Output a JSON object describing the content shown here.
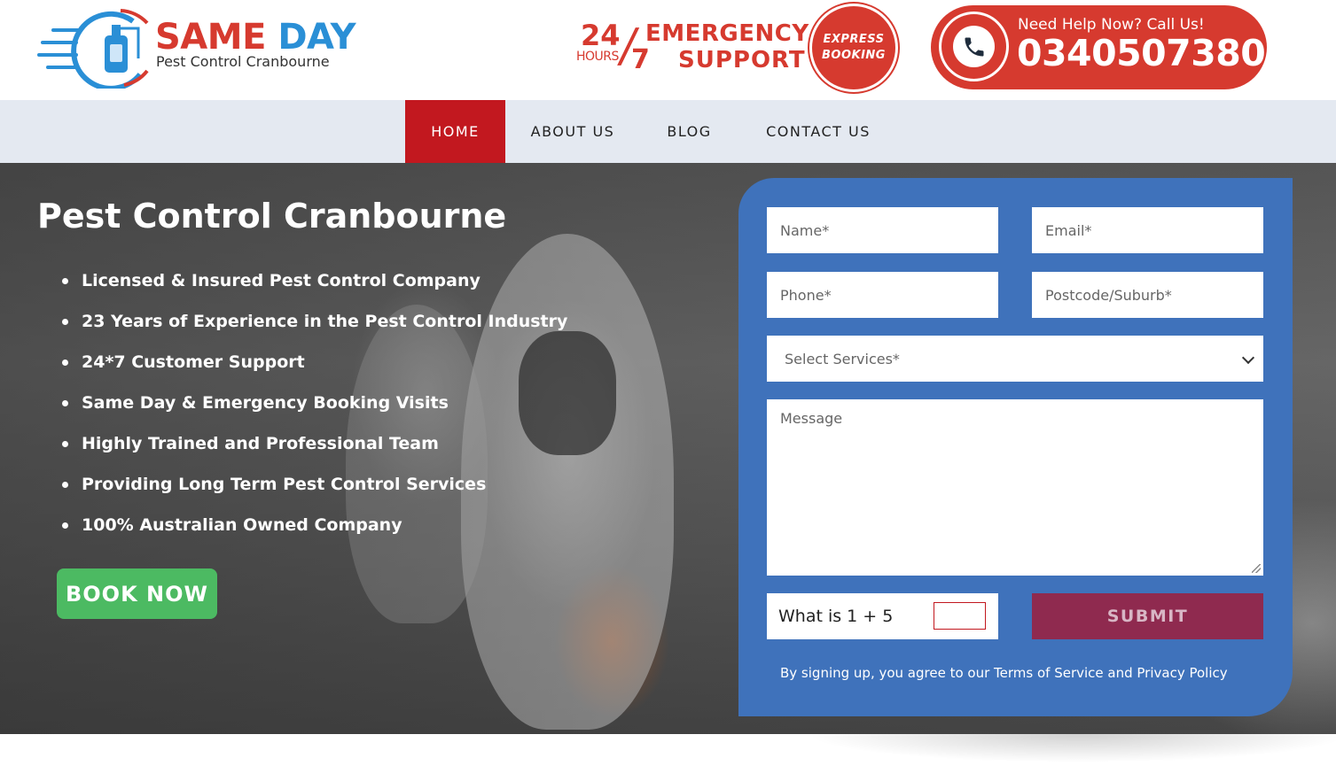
{
  "header": {
    "logo": {
      "title_part1": "SAME",
      "title_part2": "DAY",
      "subtitle": "Pest Control Cranbourne"
    },
    "emergency": {
      "num24": "24",
      "hours": "HOURS",
      "num7": "7",
      "line1": "EMERGENCY",
      "line2": "SUPPORT"
    },
    "express": {
      "line1": "EXPRESS",
      "line2": "BOOKING"
    },
    "call": {
      "label": "Need Help Now? Call Us!",
      "number": "0340507380",
      "icon": "phone-icon"
    }
  },
  "nav": {
    "items": [
      {
        "label": "HOME",
        "active": true
      },
      {
        "label": "ABOUT US",
        "active": false
      },
      {
        "label": "BLOG",
        "active": false
      },
      {
        "label": "CONTACT US",
        "active": false
      }
    ]
  },
  "hero": {
    "title": "Pest Control Cranbourne",
    "bullets": [
      "Licensed & Insured Pest Control Company",
      "23 Years of Experience in the Pest Control Industry",
      "24*7 Customer Support",
      "Same Day & Emergency Booking Visits",
      "Highly Trained and Professional Team",
      "Providing Long Term Pest Control Services",
      "100% Australian Owned Company"
    ],
    "book_label": "BOOK NOW"
  },
  "form": {
    "name_placeholder": "Name*",
    "email_placeholder": "Email*",
    "phone_placeholder": "Phone*",
    "postcode_placeholder": "Postcode/Suburb*",
    "service_selected": "Select Services*",
    "message_placeholder": "Message",
    "captcha_question": "What is 1 + 5",
    "submit_label": "SUBMIT",
    "terms": "By signing up, you agree to our Terms of Service and Privacy Policy"
  },
  "colors": {
    "brand_red": "#d63a2f",
    "nav_active": "#c2181f",
    "form_blue": "#3f72bb",
    "book_green": "#4cba62",
    "submit": "#8f2a4f"
  }
}
